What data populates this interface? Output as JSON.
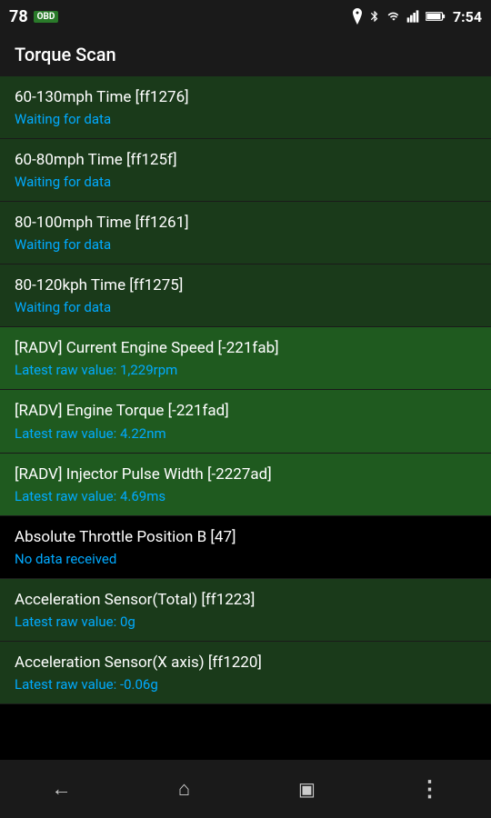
{
  "statusBar": {
    "number": "78",
    "obdLabel": "OBD",
    "time": "7:54",
    "icons": [
      "location",
      "bluetooth",
      "wifi",
      "signal",
      "battery"
    ]
  },
  "titleBar": {
    "title": "Torque Scan"
  },
  "listItems": [
    {
      "id": "item-60-130",
      "title": "60-130mph Time [ff1276]",
      "value": "Waiting for data",
      "bg": "dark-green"
    },
    {
      "id": "item-60-80",
      "title": "60-80mph Time [ff125f]",
      "value": "Waiting for data",
      "bg": "dark-green"
    },
    {
      "id": "item-80-100",
      "title": "80-100mph Time [ff1261]",
      "value": "Waiting for data",
      "bg": "dark-green"
    },
    {
      "id": "item-80-120",
      "title": "80-120kph Time [ff1275]",
      "value": "Waiting for data",
      "bg": "dark-green"
    },
    {
      "id": "item-radv-engine-speed",
      "title": "[RADV] Current Engine Speed [-221fab]",
      "value": "Latest raw value: 1,229rpm",
      "bg": "bright-green"
    },
    {
      "id": "item-radv-engine-torque",
      "title": "[RADV] Engine Torque [-221fad]",
      "value": "Latest raw value: 4.22nm",
      "bg": "bright-green"
    },
    {
      "id": "item-radv-injector",
      "title": "[RADV] Injector Pulse Width [-2227ad]",
      "value": "Latest raw value: 4.69ms",
      "bg": "bright-green"
    },
    {
      "id": "item-throttle",
      "title": "Absolute Throttle Position B [47]",
      "value": "No data received",
      "bg": "black"
    },
    {
      "id": "item-accel-total",
      "title": "Acceleration Sensor(Total) [ff1223]",
      "value": "Latest raw value: 0g",
      "bg": "dark-green"
    },
    {
      "id": "item-accel-x",
      "title": "Acceleration Sensor(X axis) [ff1220]",
      "value": "Latest raw value: -0.06g",
      "bg": "dark-green"
    }
  ],
  "navBar": {
    "back": "back",
    "home": "home",
    "recents": "recents",
    "more": "more"
  }
}
